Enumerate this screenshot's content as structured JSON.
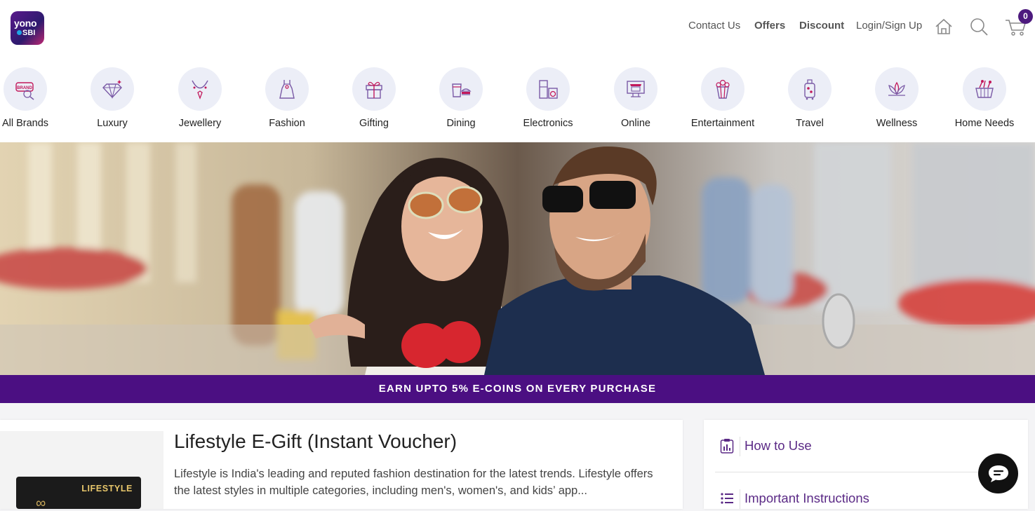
{
  "header": {
    "logo_line1": "yono",
    "logo_line2": "SBI",
    "nav": [
      {
        "label": "Contact Us"
      },
      {
        "label": "Offers"
      },
      {
        "label": "Discount"
      },
      {
        "label": "Login/Sign Up"
      }
    ],
    "icons": [
      "home-icon",
      "search-icon",
      "cart-icon"
    ],
    "cart_count": "0"
  },
  "categories": [
    {
      "label": "All Brands",
      "icon": "brand-tag-icon"
    },
    {
      "label": "Luxury",
      "icon": "diamond-icon"
    },
    {
      "label": "Jewellery",
      "icon": "necklace-icon"
    },
    {
      "label": "Fashion",
      "icon": "dress-icon"
    },
    {
      "label": "Gifting",
      "icon": "gift-icon"
    },
    {
      "label": "Dining",
      "icon": "dining-icon"
    },
    {
      "label": "Electronics",
      "icon": "appliance-icon"
    },
    {
      "label": "Online",
      "icon": "online-store-icon"
    },
    {
      "label": "Entertainment",
      "icon": "popcorn-icon"
    },
    {
      "label": "Travel",
      "icon": "luggage-icon"
    },
    {
      "label": "Wellness",
      "icon": "lotus-icon"
    },
    {
      "label": "Home Needs",
      "icon": "basket-icon"
    }
  ],
  "promo_banner": "EARN UPTO 5% E-COINS ON EVERY PURCHASE",
  "product": {
    "card_brand": "LIFESTYLE",
    "title": "Lifestyle E-Gift (Instant Voucher)",
    "description": "Lifestyle is India's leading and reputed fashion destination for the latest trends. Lifestyle offers the latest styles in multiple categories, including men's, women's, and kids’ app..."
  },
  "side_panel": {
    "items": [
      {
        "label": "How to Use",
        "icon": "clipboard-chart-icon"
      },
      {
        "label": "Important Instructions",
        "icon": "list-icon"
      }
    ]
  },
  "colors": {
    "brand_purple": "#4b0f82",
    "link_purple": "#5b2a86",
    "category_circle": "#eceef7",
    "icon_accent": "#c2185b"
  }
}
